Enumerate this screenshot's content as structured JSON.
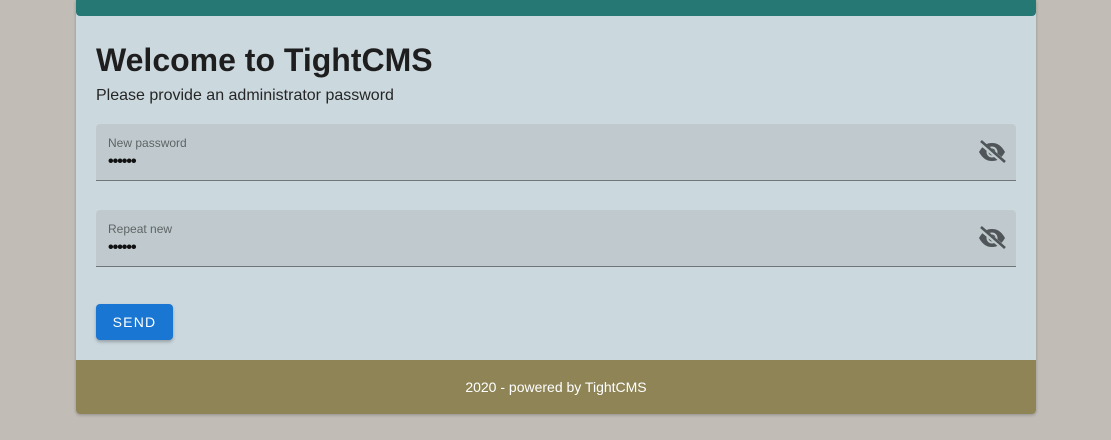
{
  "header": {
    "title": "Welcome to TightCMS",
    "subtitle": "Please provide an administrator password"
  },
  "form": {
    "new_password": {
      "label": "New password",
      "value": "••••••",
      "toggle_icon": "visibility-off-icon"
    },
    "repeat_password": {
      "label": "Repeat new",
      "value": "••••••",
      "toggle_icon": "visibility-off-icon"
    },
    "send_label": "SEND"
  },
  "footer": {
    "text": "2020 - powered by TightCMS"
  },
  "colors": {
    "top_bar": "#267874",
    "card_bg": "#cbd8de",
    "page_bg": "#c1bcb6",
    "footer_bg": "#8e8456",
    "button": "#1976d2"
  }
}
